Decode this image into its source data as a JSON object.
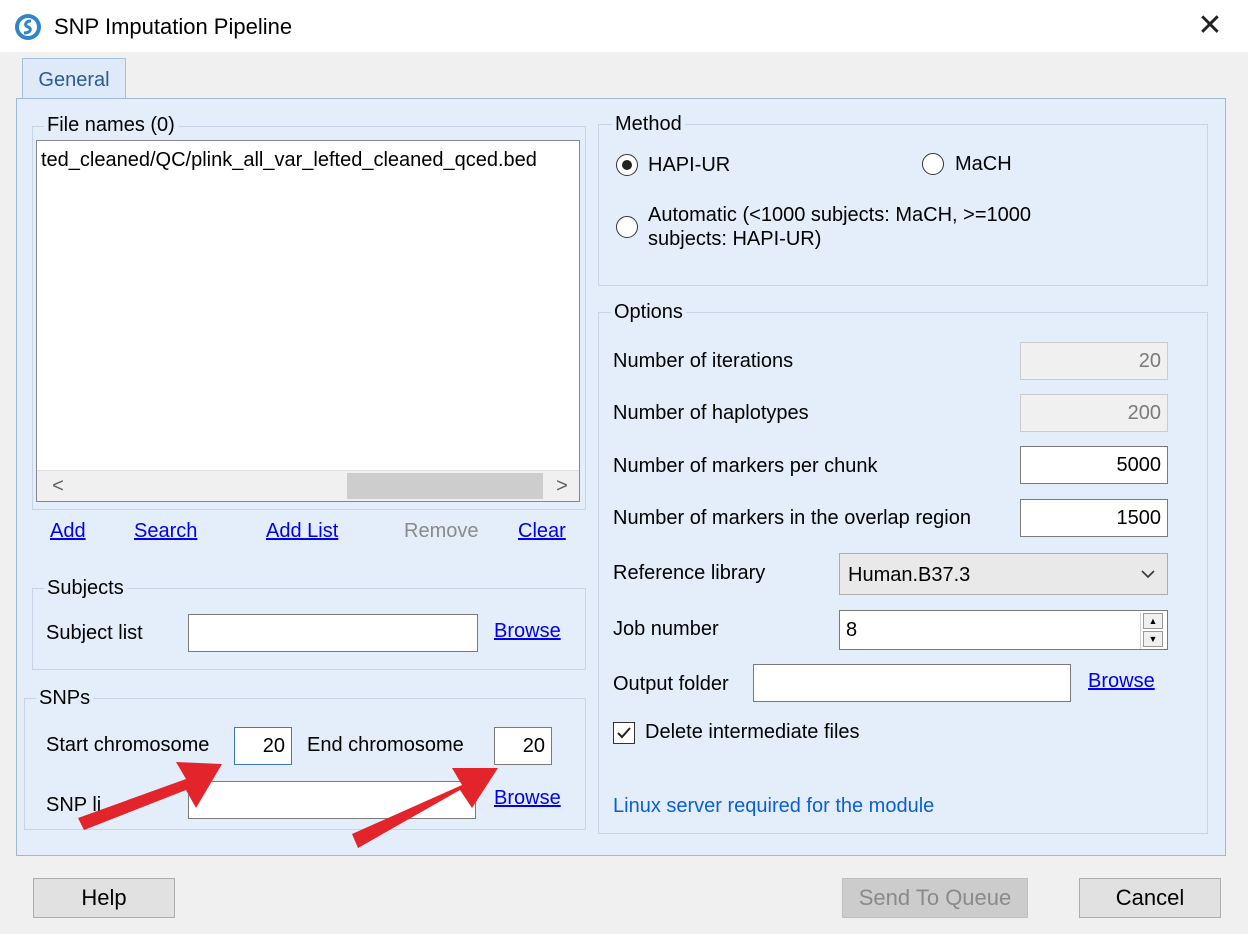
{
  "window": {
    "title": "SNP Imputation Pipeline",
    "close_symbol": "✕"
  },
  "tabs": [
    {
      "label": "General"
    }
  ],
  "file_names": {
    "title": "File names (0)",
    "items": [
      "ted_cleaned/QC/plink_all_var_lefted_cleaned_qced.bed"
    ],
    "scroll_left": "<",
    "scroll_right": ">",
    "actions": {
      "add": "Add",
      "search": "Search",
      "add_list": "Add List",
      "remove": "Remove",
      "clear": "Clear"
    }
  },
  "subjects": {
    "title": "Subjects",
    "subject_list_label": "Subject list",
    "subject_list_value": "",
    "browse": "Browse"
  },
  "snps": {
    "title": "SNPs",
    "start_label": "Start chromosome",
    "start_value": "20",
    "end_label": "End chromosome",
    "end_value": "20",
    "snp_list_label": "SNP li",
    "snp_list_value": "",
    "browse": "Browse"
  },
  "method": {
    "title": "Method",
    "options": [
      {
        "label": "HAPI-UR",
        "selected": true
      },
      {
        "label": "MaCH",
        "selected": false
      },
      {
        "label": "Automatic (<1000 subjects: MaCH, >=1000",
        "label2": "subjects: HAPI-UR)",
        "selected": false
      }
    ]
  },
  "options": {
    "title": "Options",
    "iterations_label": "Number of iterations",
    "iterations_value": "20",
    "haplotypes_label": "Number of haplotypes",
    "haplotypes_value": "200",
    "markers_chunk_label": "Number of markers per chunk",
    "markers_chunk_value": "5000",
    "markers_overlap_label": "Number of markers in the overlap region",
    "markers_overlap_value": "1500",
    "reference_label": "Reference library",
    "reference_value": "Human.B37.3",
    "job_label": "Job number",
    "job_value": "8",
    "output_label": "Output folder",
    "output_value": "",
    "output_browse": "Browse",
    "delete_label": "Delete intermediate files",
    "delete_checked": true,
    "note": "Linux server required for the module"
  },
  "footer": {
    "help": "Help",
    "send": "Send To Queue",
    "cancel": "Cancel"
  },
  "colors": {
    "panel_bg": "#e4eefb",
    "link": "#0000ee",
    "note": "#0b5ed7",
    "arrow": "#e3242b"
  }
}
